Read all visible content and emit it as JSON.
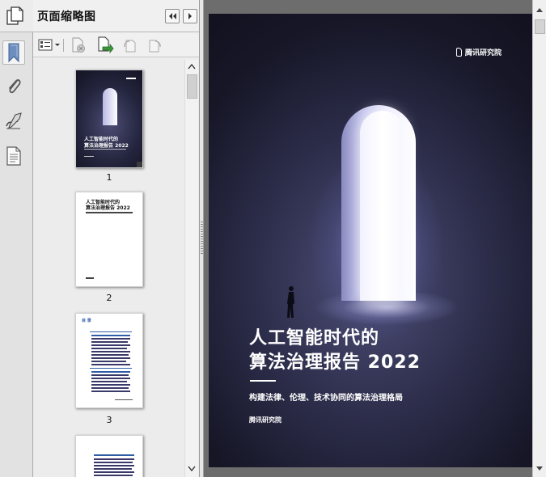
{
  "panel": {
    "title": "页面缩略图"
  },
  "thumbnails": [
    {
      "page_number": "1",
      "title_line1": "人工智能时代的",
      "title_line2": "算法治理报告 2022"
    },
    {
      "page_number": "2",
      "title_line1": "人工智能时代的",
      "title_line2": "算法治理报告 2022"
    },
    {
      "page_number": "3",
      "heading": "目 录"
    },
    {
      "page_number": ""
    }
  ],
  "document": {
    "logo_text": "腾讯研究院",
    "title_line1": "人工智能时代的",
    "title_line2": "算法治理报告 2022",
    "subtitle": "构建法律、伦理、技术协同的算法治理格局",
    "publisher": "腾讯研究院"
  },
  "icons": {
    "rail": [
      "pages-icon",
      "bookmark-icon",
      "attachment-icon",
      "signature-icon",
      "document-icon"
    ],
    "toolbar": [
      "options-icon",
      "delete-page-icon",
      "insert-page-icon",
      "rotate-left-icon",
      "rotate-right-icon"
    ]
  },
  "colors": {
    "cover_background": "#1c1d33",
    "panel_background": "#f0f0f0",
    "doc_background": "#6d6d6d",
    "bookmark_blue": "#5b7fb0"
  }
}
